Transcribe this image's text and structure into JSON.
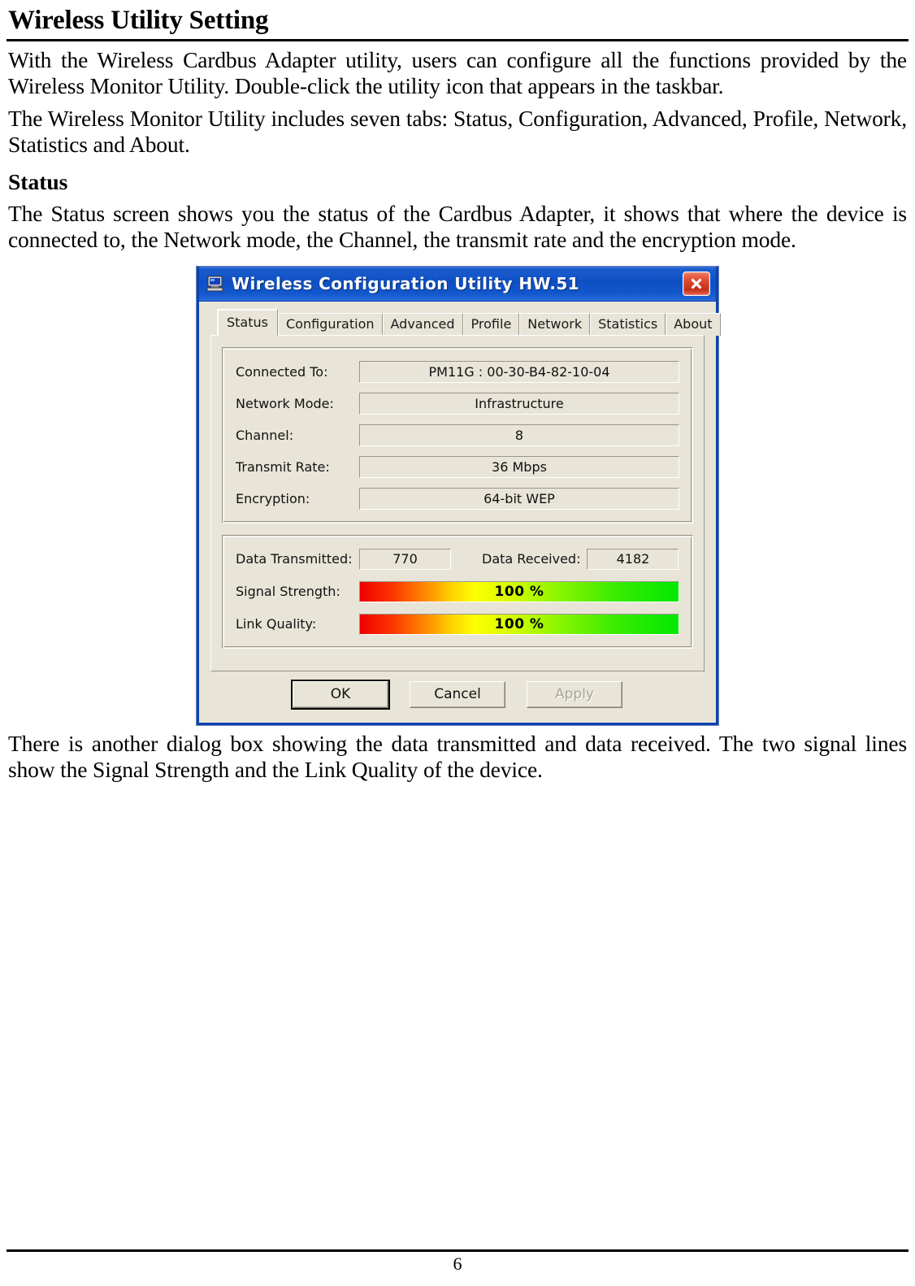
{
  "document": {
    "heading": "Wireless Utility Setting",
    "paragraph_1": "With the Wireless Cardbus Adapter utility, users can configure all the functions provided by the Wireless Monitor Utility. Double-click the utility icon that appears in the taskbar.",
    "paragraph_2": "The Wireless Monitor Utility includes seven tabs: Status, Configuration, Advanced, Profile, Network, Statistics and About.",
    "sub_heading": "Status",
    "paragraph_3": "The Status screen shows you the status of the Cardbus Adapter, it shows that where the device is connected to, the Network mode, the Channel, the transmit rate and the encryption mode.",
    "paragraph_4": "There is another dialog box showing the data transmitted and data received. The two signal lines show the Signal Strength and the Link Quality of the device.",
    "page_number": "6"
  },
  "dialog": {
    "title": "Wireless Configuration Utility HW.51",
    "title_icon": "computer-icon",
    "close_icon": "close-icon",
    "titlebar_color": "#0f4fc4",
    "face_color": "#E8E4D8",
    "tabs": [
      {
        "label": "Status",
        "active": true
      },
      {
        "label": "Configuration",
        "active": false
      },
      {
        "label": "Advanced",
        "active": false
      },
      {
        "label": "Profile",
        "active": false
      },
      {
        "label": "Network",
        "active": false
      },
      {
        "label": "Statistics",
        "active": false
      },
      {
        "label": "About",
        "active": false
      }
    ],
    "status_fields": [
      {
        "label": "Connected To:",
        "value": "PM11G : 00-30-B4-82-10-04"
      },
      {
        "label": "Network Mode:",
        "value": "Infrastructure"
      },
      {
        "label": "Channel:",
        "value": "8"
      },
      {
        "label": "Transmit Rate:",
        "value": "36 Mbps"
      },
      {
        "label": "Encryption:",
        "value": "64-bit WEP"
      }
    ],
    "counters": {
      "tx_label": "Data Transmitted:",
      "tx_value": "770",
      "rx_label": "Data Received:",
      "rx_value": "4182"
    },
    "meters": [
      {
        "label": "Signal Strength:",
        "text": "100 %",
        "percent": 100
      },
      {
        "label": "Link Quality:",
        "text": "100 %",
        "percent": 100
      }
    ],
    "buttons": [
      {
        "label": "OK",
        "state": "default"
      },
      {
        "label": "Cancel",
        "state": "normal"
      },
      {
        "label": "Apply",
        "state": "disabled"
      }
    ]
  }
}
